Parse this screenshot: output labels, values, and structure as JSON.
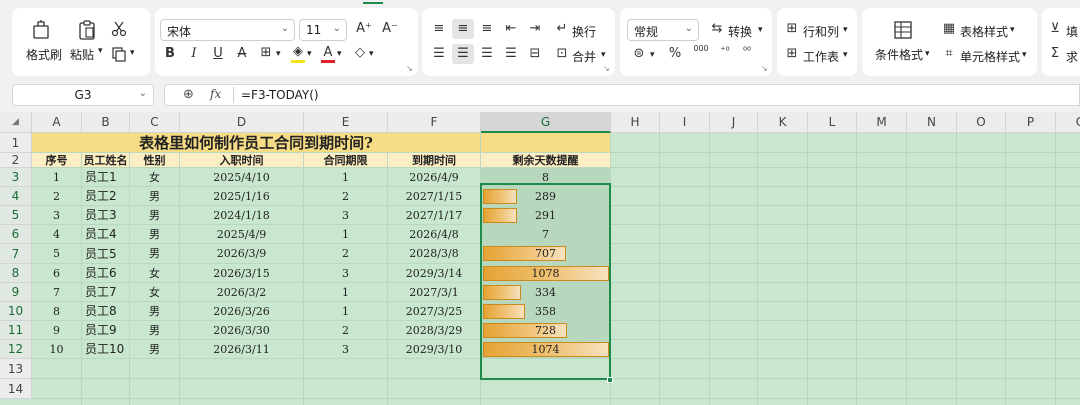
{
  "ribbon": {
    "format_painter": "格式刷",
    "paste": "粘贴",
    "font_name": "宋体",
    "font_size": "11",
    "bold": "B",
    "italic": "I",
    "underline": "U",
    "strike": "A",
    "wrap": "换行",
    "merge": "合并",
    "number_format": "常规",
    "convert": "转换",
    "percent": "%",
    "thousands": "000",
    "row_col": "行和列",
    "worksheet": "工作表",
    "conditional_format": "条件格式",
    "table_style": "表格样式",
    "cell_style": "单元格样式",
    "fill": "填",
    "sum": "求"
  },
  "formula_bar": {
    "cell_ref": "G3",
    "formula": "=F3-TODAY()",
    "fx": "fx"
  },
  "columns": [
    "A",
    "B",
    "C",
    "D",
    "E",
    "F",
    "G",
    "H",
    "I",
    "J",
    "K",
    "L",
    "M",
    "N",
    "O",
    "P",
    "Q"
  ],
  "rows": [
    "1",
    "2",
    "3",
    "4",
    "5",
    "6",
    "7",
    "8",
    "9",
    "10",
    "11",
    "12",
    "13",
    "14"
  ],
  "table": {
    "title": "表格里如何制作员工合同到期时间?",
    "headers": [
      "序号",
      "员工姓名",
      "性别",
      "入职时间",
      "合同期限",
      "到期时间",
      "剩余天数提醒"
    ],
    "records": [
      {
        "no": "1",
        "name": "员工1",
        "gender": "女",
        "start": "2025/4/10",
        "term": "1",
        "end": "2026/4/9",
        "days": "8",
        "fill": 0.0
      },
      {
        "no": "2",
        "name": "员工2",
        "gender": "男",
        "start": "2025/1/16",
        "term": "2",
        "end": "2027/1/15",
        "days": "289",
        "fill": 0.27
      },
      {
        "no": "3",
        "name": "员工3",
        "gender": "男",
        "start": "2024/1/18",
        "term": "3",
        "end": "2027/1/17",
        "days": "291",
        "fill": 0.27
      },
      {
        "no": "4",
        "name": "员工4",
        "gender": "男",
        "start": "2025/4/9",
        "term": "1",
        "end": "2026/4/8",
        "days": "7",
        "fill": 0.0
      },
      {
        "no": "5",
        "name": "员工5",
        "gender": "男",
        "start": "2026/3/9",
        "term": "2",
        "end": "2028/3/8",
        "days": "707",
        "fill": 0.66
      },
      {
        "no": "6",
        "name": "员工6",
        "gender": "女",
        "start": "2026/3/15",
        "term": "3",
        "end": "2029/3/14",
        "days": "1078",
        "fill": 1.0
      },
      {
        "no": "7",
        "name": "员工7",
        "gender": "女",
        "start": "2026/3/2",
        "term": "1",
        "end": "2027/3/1",
        "days": "334",
        "fill": 0.3
      },
      {
        "no": "8",
        "name": "员工8",
        "gender": "男",
        "start": "2026/3/26",
        "term": "1",
        "end": "2027/3/25",
        "days": "358",
        "fill": 0.33
      },
      {
        "no": "9",
        "name": "员工9",
        "gender": "男",
        "start": "2026/3/30",
        "term": "2",
        "end": "2028/3/29",
        "days": "728",
        "fill": 0.67
      },
      {
        "no": "10",
        "name": "员工10",
        "gender": "男",
        "start": "2026/3/11",
        "term": "3",
        "end": "2029/3/10",
        "days": "1074",
        "fill": 1.0
      }
    ]
  },
  "colors": {
    "title_bg": "#f7dc86",
    "header_bg": "#fbeec3",
    "sheet_bg": "#c9e7cf",
    "accent": "#1e8a4c",
    "bar": "#e6a333"
  }
}
